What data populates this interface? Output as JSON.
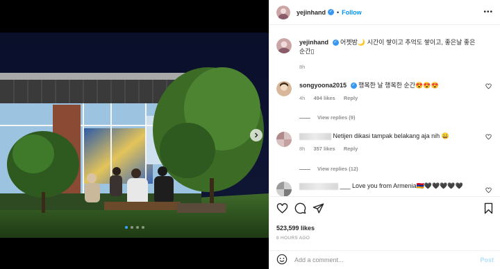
{
  "post": {
    "username": "yejinhand",
    "follow_label": "Follow",
    "separator": "•",
    "more": "•••",
    "caption": "어젯밤🌙 시간이 쌓이고 추억도 쌓이고, 좋은날 좋은 순간▯",
    "caption_time": "8h",
    "likes": "523,599 likes",
    "time_ago": "8 HOURS AGO",
    "carousel_dots": 4,
    "carousel_active": 0
  },
  "comments": [
    {
      "username": "songyoona2015",
      "verified": true,
      "text": "행복한 날 행복한 순간😍😍😍",
      "time": "4h",
      "likes": "494 likes",
      "reply_label": "Reply",
      "view_replies": "View replies (9)"
    },
    {
      "username": "",
      "text": "Netijen dikasi tampak belakang aja nih 😀",
      "time": "8h",
      "likes": "357 likes",
      "reply_label": "Reply",
      "view_replies": "View replies (12)"
    },
    {
      "username": "",
      "text": "___ Love you from Armenia🇦🇲🖤🖤🖤🖤🖤"
    }
  ],
  "composer": {
    "placeholder": "Add a comment...",
    "post_label": "Post"
  },
  "icons": {
    "like": "heart-icon",
    "comment": "comment-icon",
    "share": "share-icon",
    "save": "bookmark-icon",
    "emoji": "emoji-icon",
    "next": "chevron-right-icon"
  },
  "colors": {
    "accent": "#0095f6",
    "verified": "#3897f0",
    "muted": "#8e8e8e"
  }
}
